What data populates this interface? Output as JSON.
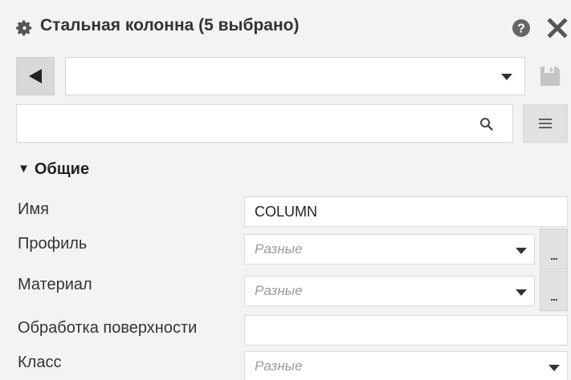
{
  "window": {
    "title": "Стальная колонна (5 выбрано)",
    "icons": {
      "settings": "gear-icon",
      "help": "help-icon",
      "close": "close-icon"
    }
  },
  "toolbar": {
    "back_icon": "back-triangle-icon",
    "preset_value": "",
    "save_icon": "save-disk-icon"
  },
  "search": {
    "value": "",
    "placeholder": "",
    "menu_icon": "hamburger-menu-icon"
  },
  "section": {
    "label": "Общие",
    "expanded": true
  },
  "properties": [
    {
      "label": "Имя",
      "value": "COLUMN",
      "placeholder": false,
      "dropdown": false,
      "dots": false
    },
    {
      "label": "Профиль",
      "value": "Разные",
      "placeholder": true,
      "dropdown": true,
      "dots": true
    },
    {
      "label": "Материал",
      "value": "Разные",
      "placeholder": true,
      "dropdown": true,
      "dots": true
    },
    {
      "label": "Обработка поверхности",
      "value": "",
      "placeholder": false,
      "dropdown": false,
      "dots": false
    },
    {
      "label": "Класс",
      "value": "Разные",
      "placeholder": true,
      "dropdown": true,
      "dots": false
    }
  ],
  "dots_label": "...",
  "colors": {
    "background": "#f3f3f3",
    "field_background": "#ffffff",
    "button_background": "#d8d8d8",
    "disabled_icon": "#c4c4c4",
    "placeholder_text": "#9a9a9a"
  }
}
